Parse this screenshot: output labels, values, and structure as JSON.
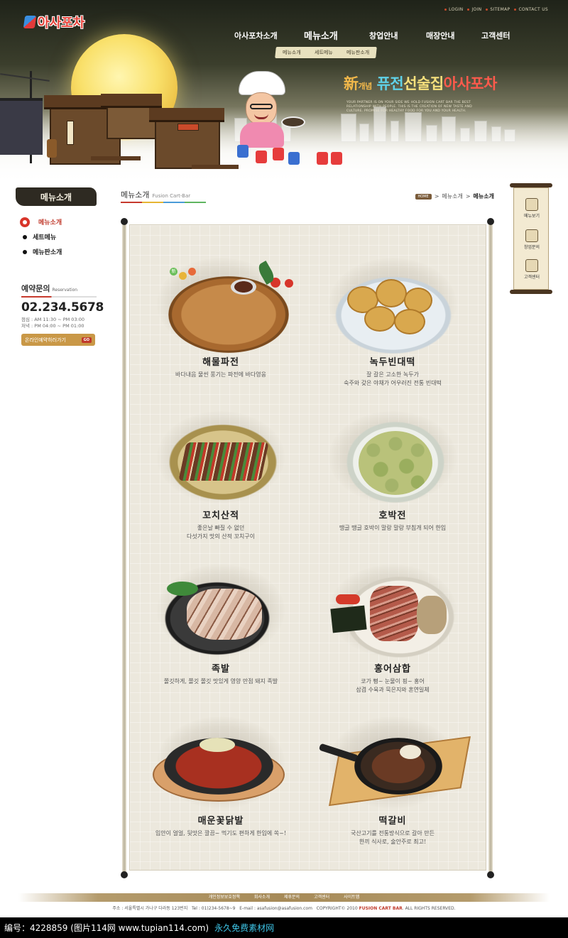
{
  "header": {
    "utility": [
      "LOGIN",
      "JOIN",
      "SITEMAP",
      "CONTACT US"
    ],
    "logo": "아사포차",
    "gnb": [
      "아사포차소개",
      "메뉴소개",
      "창업안내",
      "매장안내",
      "고객센터"
    ],
    "sub_gnb": [
      "메뉴소개",
      "세트메뉴",
      "메뉴판소개"
    ],
    "slogan": {
      "a": "新",
      "b": "개념",
      "c": "퓨전",
      "d": "선술집",
      "e": "아사포차"
    },
    "slogan_sub": "YOUR PARTNER IS ON YOUR SIDE WE HOLD FUSION CART BAR THE BEST RELATIONSHIP WITH PEOPLE. THIS IS THE CREATION OF NEW TASTE AND CULTURE. PROMISE FOR HEALTHY FOOD FOR YOU AND YOUR HEALTH."
  },
  "sidebar": {
    "title": "메뉴소개",
    "items": [
      "메뉴소개",
      "세트메뉴",
      "메뉴판소개"
    ],
    "reservation": {
      "heading": "예약문의",
      "heading_en": "Reservation",
      "phone": "02.234.5678",
      "hours_1": "점심 : AM 11:30 ~ PM 03:00",
      "hours_2": "저녁 : PM 04:00 ~ PM 01:00",
      "button": "온라인예약하러가기",
      "button_tag": "GO"
    }
  },
  "content": {
    "title_ko": "메뉴소개",
    "title_en": "Fusion Cart-Bar",
    "breadcrumb": {
      "home": "HOME",
      "level1": "메뉴소개",
      "current": "메뉴소개"
    }
  },
  "menu": [
    {
      "name": "해물파전",
      "desc1": "바다내음 물씬 풍기는 파전에 바다영웅",
      "desc2": ""
    },
    {
      "name": "녹두빈대떡",
      "desc1": "잘 갈은 고소한 녹두가",
      "desc2": "숙주와 갖은 야채가 어우러진 전통 빈대떡"
    },
    {
      "name": "꼬치산적",
      "desc1": "좋은날 빠질 수 없던",
      "desc2": "다섯가지 맛의 산적 꼬치구이"
    },
    {
      "name": "호박전",
      "desc1": "땡글 땡글 호박이 말랑 말랑 부침개 되어 한입",
      "desc2": ""
    },
    {
      "name": "족발",
      "desc1": "쫄깃하게, 쫄깃 쫄깃 맛있게 영양 만점 돼지 족발",
      "desc2": ""
    },
    {
      "name": "홍어삼합",
      "desc1": "코가 뻥~ 눈물이 핑~ 홍어",
      "desc2": "삼겹 수육과 묵은지와 혼연일체"
    },
    {
      "name": "매운꽃닭발",
      "desc1": "입안이 얼얼, 뒷맛은 깔끔~ 먹기도 편하게 한입에 쏙~!",
      "desc2": ""
    },
    {
      "name": "떡갈비",
      "desc1": "국산고기를 전통방식으로 갈아 만든",
      "desc2": "한끼 식사로, 술안주로 최고!"
    }
  ],
  "badge": "新",
  "quick_menu": [
    "메뉴보기",
    "창업문의",
    "고객센터"
  ],
  "footer": {
    "links": [
      "개인정보보호정책",
      "회사소개",
      "제휴문의",
      "고객센터",
      "사이트맵"
    ],
    "address": "주소 : 서울특별시 가나구 다라동 123번지",
    "tel": "Tel : 01)234-5678~9",
    "email": "E-mail : asafusion@asafusion.com",
    "copyright_pre": "COPYRIGHT© 2010",
    "copyright_brand": "FUSION CART BAR",
    "copyright_post": ". ALL RIGHTS RESERVED."
  },
  "watermark": {
    "left": "编号：4228859 (图片114网 www.tupian114.com)",
    "right": "永久免费素材网"
  }
}
